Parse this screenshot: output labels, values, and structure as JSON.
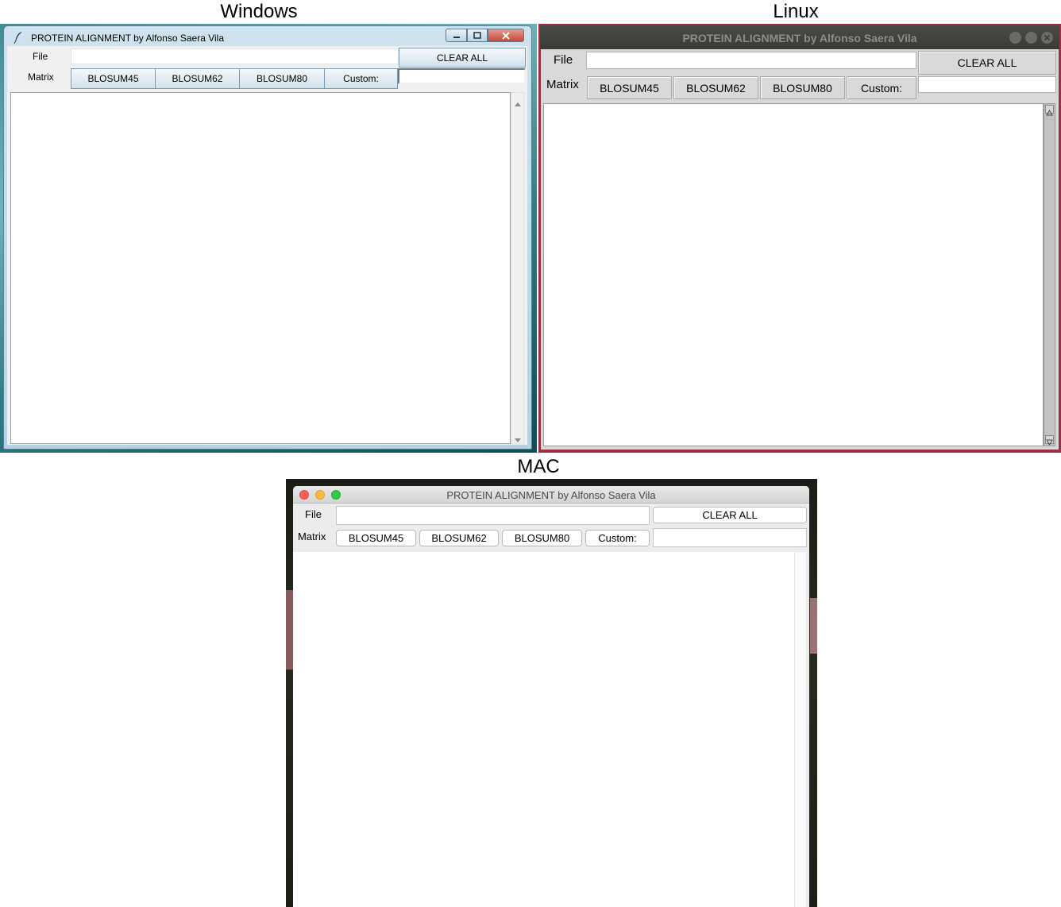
{
  "labels": {
    "windows": "Windows",
    "linux": "Linux",
    "mac": "MAC"
  },
  "app": {
    "title": "PROTEIN ALIGNMENT by Alfonso Saera Vila",
    "file_label": "File",
    "matrix_label": "Matrix",
    "clear_all": "CLEAR ALL",
    "matrices": [
      "BLOSUM45",
      "BLOSUM62",
      "BLOSUM80"
    ],
    "custom_label": "Custom:",
    "file_value": "",
    "custom_value": "",
    "output_text": ""
  },
  "icons": {
    "windows_app_icon": "feather-icon",
    "windows_minimize": "minimize-icon",
    "windows_maximize": "maximize-icon",
    "windows_close": "close-icon",
    "mac_close": "close-light",
    "mac_minimize": "minimize-light",
    "mac_zoom": "zoom-light"
  },
  "colors": {
    "linux_border": "#9c2f43",
    "windows_close": "#c9453b",
    "mac_close": "#fc605b",
    "mac_minimize": "#fdbc40",
    "mac_zoom": "#34c84a"
  }
}
